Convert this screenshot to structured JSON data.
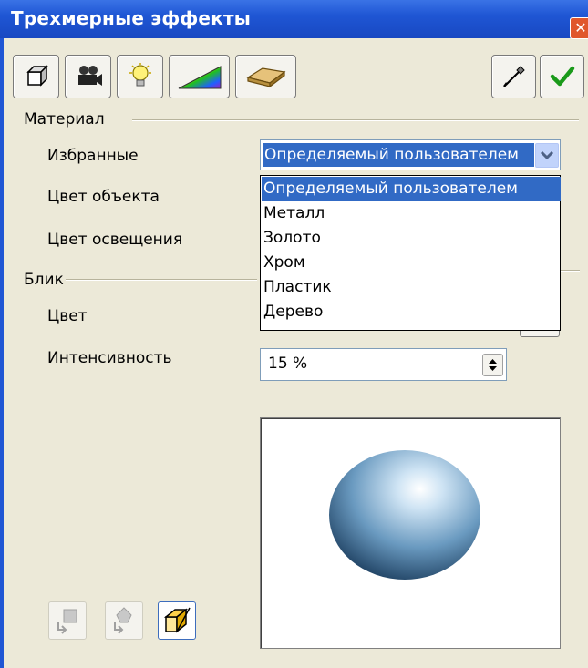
{
  "window": {
    "title": "Трехмерные эффекты",
    "close_glyph": "✕"
  },
  "toolbar": {
    "buttons": [
      {
        "name": "geometry-icon"
      },
      {
        "name": "shading-camera-icon"
      },
      {
        "name": "illumination-bulb-icon"
      },
      {
        "name": "textures-gradient-icon"
      },
      {
        "name": "material-bar-icon"
      }
    ],
    "right_buttons": [
      {
        "name": "pipette-icon"
      },
      {
        "name": "apply-checkmark-icon"
      }
    ]
  },
  "material": {
    "section_label": "Материал",
    "favorites_label": "Избранные",
    "favorites_value": "Определяемый пользователем",
    "object_color_label": "Цвет объекта",
    "illumination_color_label": "Цвет освещения",
    "options": [
      "Определяемый пользователем",
      "Металл",
      "Золото",
      "Хром",
      "Пластик",
      "Дерево"
    ],
    "selected_index": 0
  },
  "specular": {
    "section_label": "Блик",
    "color_label": "Цвет",
    "intensity_label": "Интенсивность",
    "intensity_value": "15 %"
  },
  "bottom_buttons": [
    {
      "name": "convert-to-3d-icon",
      "enabled": false
    },
    {
      "name": "convert-to-rotation-icon",
      "enabled": false
    },
    {
      "name": "perspective-icon",
      "enabled": true
    }
  ],
  "colors": {
    "titlebar": "#1f56d4",
    "selection": "#316ac5",
    "dialog_bg": "#ece9d8"
  }
}
